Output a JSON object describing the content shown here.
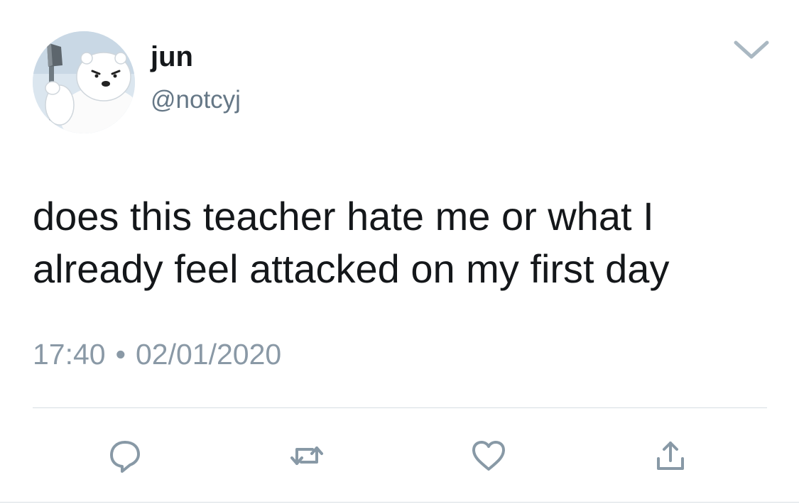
{
  "author": {
    "display_name": "jun",
    "handle": "@notcyj",
    "avatar_icon": "polar-bear-with-axe-icon"
  },
  "tweet": {
    "lines": [
      "does this teacher hate me or what I",
      "already feel attacked on my first day"
    ]
  },
  "meta": {
    "time": "17:40",
    "separator": "•",
    "date": "02/01/2020"
  },
  "actions": [
    {
      "name": "reply",
      "icon": "reply-bubble-icon"
    },
    {
      "name": "retweet",
      "icon": "retweet-icon"
    },
    {
      "name": "like",
      "icon": "heart-icon"
    },
    {
      "name": "share",
      "icon": "share-icon"
    }
  ],
  "colors": {
    "text": "#14171a",
    "secondary_text": "#657786",
    "timestamp": "#8a99a6",
    "icon": "#8899a6",
    "divider": "#d6dde3"
  }
}
